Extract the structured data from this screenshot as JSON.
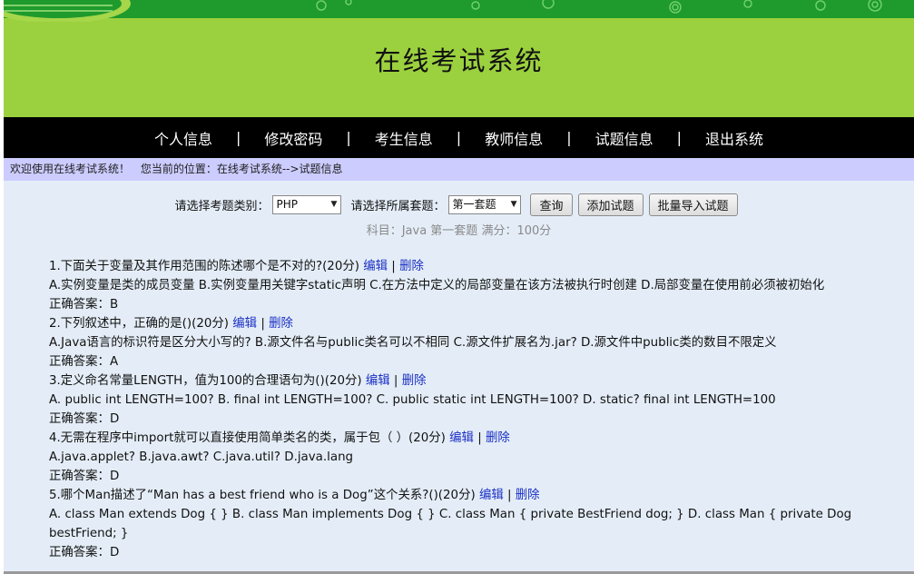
{
  "header": {
    "title": "在线考试系统"
  },
  "nav": {
    "items": [
      "个人信息",
      "修改密码",
      "考生信息",
      "教师信息",
      "试题信息",
      "退出系统"
    ],
    "separator": "|"
  },
  "breadcrumb": {
    "welcome": "欢迎使用在线考试系统！",
    "location": "您当前的位置：在线考试系统-->试题信息"
  },
  "toolbar": {
    "category_label": "请选择考题类别：",
    "category_value": "PHP",
    "set_label": "请选择所属套题：",
    "set_value": "第一套题",
    "query_button": "查询",
    "add_button": "添加试题",
    "import_button": "批量导入试题"
  },
  "subinfo": "科目：Java  第一套题  满分：100分",
  "actions": {
    "edit": "编辑",
    "delete": "删除"
  },
  "questions": [
    {
      "title": "1.下面关于变量及其作用范围的陈述哪个是不对的?(20分)",
      "options": "A.实例变量是类的成员变量  B.实例变量用关键字static声明  C.在方法中定义的局部变量在该方法被执行时创建  D.局部变量在使用前必须被初始化",
      "answer": "正确答案：B"
    },
    {
      "title": "2.下列叙述中，正确的是()(20分)",
      "options": "A.Java语言的标识符是区分大小写的?  B.源文件名与public类名可以不相同  C.源文件扩展名为.jar?  D.源文件中public类的数目不限定义",
      "answer": "正确答案：A"
    },
    {
      "title": "3.定义命名常量LENGTH，值为100的合理语句为()(20分)",
      "options": "A. public int LENGTH=100?  B. final int LENGTH=100?  C. public static int LENGTH=100?  D. static? final int LENGTH=100",
      "answer": "正确答案：D"
    },
    {
      "title": "4.无需在程序中import就可以直接使用简单类名的类，属于包（ ）(20分)",
      "options": "A.java.applet?  B.java.awt?  C.java.util?  D.java.lang",
      "answer": "正确答案：D"
    },
    {
      "title": "5.哪个Man描述了“Man has a best friend who is a Dog”这个关系?()(20分)",
      "options": "A. class Man extends Dog { }  B. class Man implements Dog { }  C. class Man { private BestFriend dog; }  D. class Man { private Dog bestFriend; }",
      "answer": "正确答案：D"
    }
  ]
}
